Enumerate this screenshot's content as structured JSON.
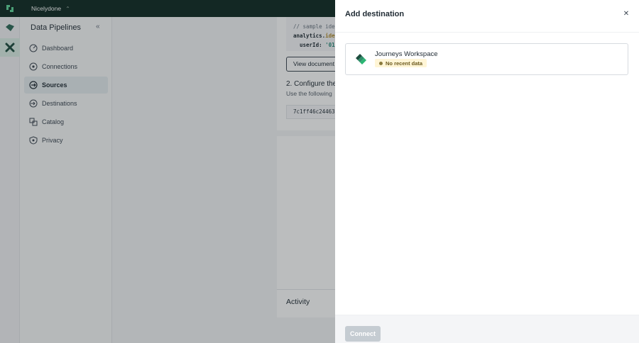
{
  "topbar": {
    "workspace": "Nicelydone",
    "chevron": "⌃"
  },
  "sidebar": {
    "title": "Data Pipelines",
    "collapse": "«",
    "items": [
      {
        "label": "Dashboard",
        "icon": "dashboard-icon"
      },
      {
        "label": "Connections",
        "icon": "connections-icon"
      },
      {
        "label": "Sources",
        "icon": "sources-icon",
        "active": true
      },
      {
        "label": "Destinations",
        "icon": "destinations-icon"
      },
      {
        "label": "Catalog",
        "icon": "catalog-icon"
      },
      {
        "label": "Privacy",
        "icon": "privacy-icon"
      }
    ]
  },
  "main": {
    "code": {
      "line1_comment": "// sample ide",
      "line2_prefix": "analytics.",
      "line2_fn": "ide",
      "line3_key": "userId:",
      "line3_val": "'01"
    },
    "view_docs_label": "View document",
    "configure_title": "2. Configure the",
    "configure_subtitle": "Use the following",
    "write_key": "7c1ff46c24463",
    "activity_title": "Activity"
  },
  "drawer": {
    "title": "Add destination",
    "close": "✕",
    "destination": {
      "name": "Journeys Workspace",
      "status": "No recent data"
    },
    "connect_label": "Connect"
  },
  "colors": {
    "brand": "#2bb673",
    "topbar": "#0f2a23",
    "badge_bg": "#fff5d6"
  }
}
